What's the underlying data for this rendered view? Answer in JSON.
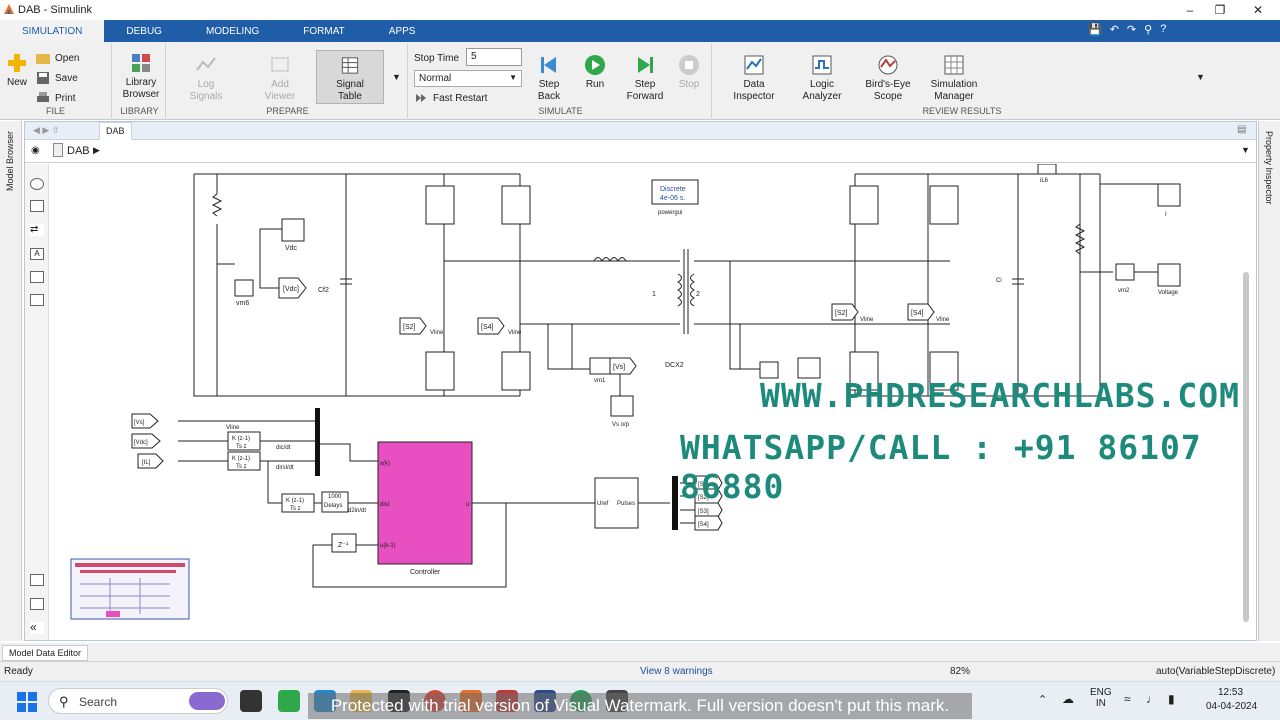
{
  "window": {
    "title": "DAB - Simulink"
  },
  "tabs": [
    "SIMULATION",
    "DEBUG",
    "MODELING",
    "FORMAT",
    "APPS"
  ],
  "ribbon": {
    "file": {
      "label": "FILE",
      "new": "New",
      "open": "Open",
      "save": "Save",
      "print": "Print"
    },
    "library": {
      "label": "LIBRARY",
      "browser_l1": "Library",
      "browser_l2": "Browser"
    },
    "prepare": {
      "label": "PREPARE",
      "log_l1": "Log",
      "log_l2": "Signals",
      "add_l1": "Add",
      "add_l2": "Viewer",
      "table_l1": "Signal",
      "table_l2": "Table"
    },
    "simulate": {
      "label": "SIMULATE",
      "stop_time_label": "Stop Time",
      "stop_time_value": "5",
      "mode": "Normal",
      "fast_restart": "Fast Restart",
      "step_back_l1": "Step",
      "step_back_l2": "Back",
      "run": "Run",
      "step_fwd_l1": "Step",
      "step_fwd_l2": "Forward",
      "stop": "Stop"
    },
    "review": {
      "label": "REVIEW RESULTS",
      "data_l1": "Data",
      "data_l2": "Inspector",
      "logic_l1": "Logic",
      "logic_l2": "Analyzer",
      "birds_l1": "Bird's-Eye",
      "birds_l2": "Scope",
      "simmgr_l1": "Simulation",
      "simmgr_l2": "Manager"
    }
  },
  "side": {
    "left_panel": "Model Browser",
    "right_panel": "Property Inspector"
  },
  "editor": {
    "tab": "DAB",
    "breadcrumb": "DAB"
  },
  "diagram": {
    "labels": {
      "vdc_scope": "Vdc",
      "vm6": "vm6",
      "vdc_goto": "[Vdc]",
      "cf2": "Cf2",
      "s2_a": "[S2]",
      "s4_a": "[S4]",
      "vline_a": "Vline",
      "vline_b": "Vline",
      "powergui_l1": "Discrete",
      "powergui_l2": "4e-06 s.",
      "powergui": "powergui",
      "t1": "1",
      "t2": "2",
      "dcx2": "DCX2",
      "vm1": "vm1",
      "vs_goto": "[Vs]",
      "vs_orp": "Vs o/p",
      "il6": "iL6",
      "i_scope": "I",
      "ci": "Ci",
      "vm2": "vm2",
      "voltage": "Voltage",
      "s2_b": "[S2]",
      "s4_b": "[S4]",
      "vline_c": "Vline",
      "vline_d": "Vline",
      "vs_from": "[Vs]",
      "vdc_from": "[Vdc]",
      "il_from": "[IL]",
      "vline_e": "Vline",
      "dtf": "K (z-1)",
      "tsz": "Ts z",
      "dicdt": "dic/dt",
      "dildt": "dirsl/dt",
      "delays_l1": "1000",
      "delays_l2": "Delays",
      "d2": "d2in/dt",
      "zinv": "Z⁻¹",
      "xk": "x(k)",
      "dist": "dist",
      "uk1": "u(k-1)",
      "u": "u",
      "controller": "Controller",
      "uref": "Uref",
      "pulses": "Pulses",
      "s1": "[S1]",
      "s2": "[S2]",
      "s3": "[S3]",
      "s4": "[S4]"
    }
  },
  "bottom": {
    "tab": "Model Data Editor"
  },
  "status": {
    "ready": "Ready",
    "warnings": "View 8 warnings",
    "zoom": "82%",
    "solver": "auto(VariableStepDiscrete)"
  },
  "watermark": {
    "line1": "WWW.PHDRESEARCHLABS.COM",
    "line2": "WHATSAPP/CALL : +91 86107 86880",
    "trial": "Protected with trial version of Visual Watermark. Full version doesn't put this mark."
  },
  "taskbar": {
    "search": "Search",
    "lang1": "ENG",
    "lang2": "IN",
    "time": "12:53",
    "date": "04-04-2024"
  },
  "colors": {
    "ribbon_blue": "#1f5da8",
    "controller_fill": "#e84fc0",
    "watermark": "#1e8a7c"
  }
}
